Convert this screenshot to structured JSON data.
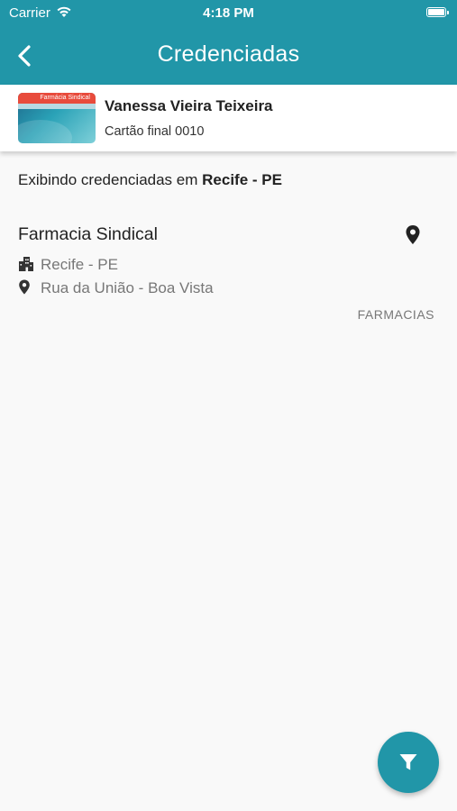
{
  "status_bar": {
    "carrier": "Carrier",
    "time": "4:18 PM"
  },
  "nav": {
    "title": "Credenciadas",
    "back_icon": "chevron-left-icon"
  },
  "card": {
    "holder_name": "Vanessa Vieira Teixeira",
    "card_number": "Cartão final 0010",
    "logo_text": "Farmácia Sindical"
  },
  "filter_info": {
    "prefix": "Exibindo credenciadas em",
    "location": "Recife - PE"
  },
  "results": [
    {
      "name": "Farmacia Sindical",
      "city": "Recife - PE",
      "address": "Rua da União - Boa Vista",
      "category": "FARMACIAS"
    }
  ],
  "fab": {
    "icon": "filter-icon"
  },
  "colors": {
    "primary": "#2196a8",
    "background": "#f9f9f9",
    "text": "#222222",
    "muted": "#777777"
  }
}
